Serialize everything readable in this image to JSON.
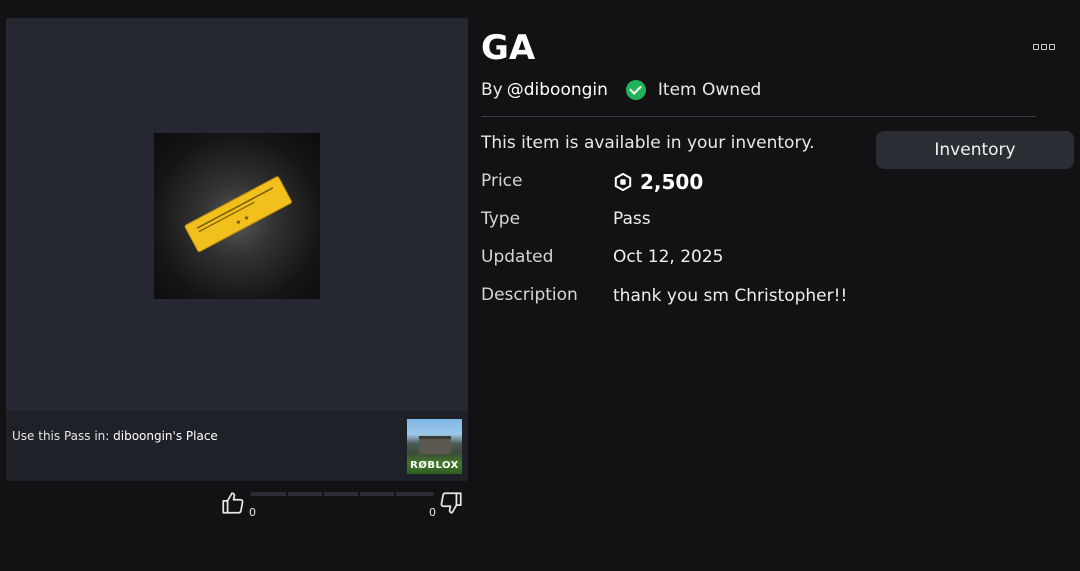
{
  "item": {
    "title": "GA",
    "by_prefix": "By",
    "creator": "@diboongin",
    "owned_label": "Item Owned",
    "available_text": "This item is available in your inventory.",
    "inventory_button": "Inventory"
  },
  "details": {
    "price_label": "Price",
    "price_value": "2,500",
    "type_label": "Type",
    "type_value": "Pass",
    "updated_label": "Updated",
    "updated_value": "Oct 12, 2025",
    "description_label": "Description",
    "description_value": "thank you sm Christopher!!"
  },
  "pass_footer": {
    "prefix": "Use this Pass in:",
    "place_name": "diboongin's Place",
    "place_logo_text": "RØBLOX"
  },
  "votes": {
    "up": "0",
    "down": "0"
  },
  "colors": {
    "background": "#121215",
    "panel": "#252831",
    "owned_green": "#1fb35a",
    "pass_gold": "#f2c01c"
  },
  "icons": [
    "more-options-icon",
    "check-circle-icon",
    "robux-icon",
    "thumbs-up-icon",
    "thumbs-down-icon"
  ]
}
